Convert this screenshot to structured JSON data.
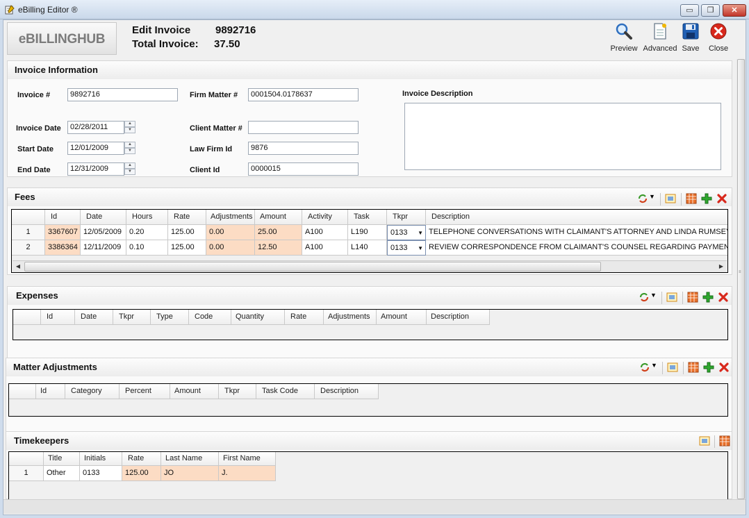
{
  "window": {
    "title": "eBilling Editor ®",
    "min_glyph": "▭",
    "max_glyph": "❐",
    "close_glyph": "✕"
  },
  "header": {
    "logo": "eBILLINGHUB",
    "edit_invoice_label": "Edit Invoice",
    "edit_invoice_value": "9892716",
    "total_invoice_label": "Total Invoice:",
    "total_invoice_value": "37.50",
    "toolbar": [
      {
        "label": "Preview",
        "icon": "magnifier-icon"
      },
      {
        "label": "Advanced",
        "icon": "document-icon"
      },
      {
        "label": "Save",
        "icon": "floppy-disk-icon"
      },
      {
        "label": "Close",
        "icon": "close-icon"
      }
    ]
  },
  "invoice_info": {
    "title": "Invoice Information",
    "invoice_no_label": "Invoice #",
    "invoice_no": "9892716",
    "invoice_date_label": "Invoice Date",
    "invoice_date": "02/28/2011",
    "start_date_label": "Start Date",
    "start_date": "12/01/2009",
    "end_date_label": "End Date",
    "end_date": "12/31/2009",
    "firm_matter_label": "Firm Matter #",
    "firm_matter": "0001504.0178637",
    "client_matter_label": "Client Matter #",
    "client_matter": "",
    "law_firm_id_label": "Law Firm Id",
    "law_firm_id": "9876",
    "client_id_label": "Client Id",
    "client_id": "0000015",
    "description_label": "Invoice Description",
    "description": ""
  },
  "fees": {
    "title": "Fees",
    "columns": [
      "",
      "Id",
      "Date",
      "Hours",
      "Rate",
      "Adjustments",
      "Amount",
      "Activity",
      "Task",
      "Tkpr",
      "Description"
    ],
    "rows": [
      [
        "1",
        "3367607",
        "12/05/2009",
        "0.20",
        "125.00",
        "0.00",
        "25.00",
        "A100",
        "L190",
        "0133",
        "TELEPHONE CONVERSATIONS WITH CLAIMANT'S ATTORNEY AND LINDA RUMSEY"
      ],
      [
        "2",
        "3386364",
        "12/11/2009",
        "0.10",
        "125.00",
        "0.00",
        "12.50",
        "A100",
        "L140",
        "0133",
        "REVIEW CORRESPONDENCE FROM CLAIMANT'S COUNSEL REGARDING PAYMENT"
      ]
    ]
  },
  "expenses": {
    "title": "Expenses",
    "columns": [
      "",
      "Id",
      "Date",
      "Tkpr",
      "Type",
      "Code",
      "Quantity",
      "Rate",
      "Adjustments",
      "Amount",
      "Description"
    ]
  },
  "matter_adjustments": {
    "title": "Matter Adjustments",
    "columns": [
      "",
      "Id",
      "Category",
      "Percent",
      "Amount",
      "Tkpr",
      "Task Code",
      "Description"
    ]
  },
  "timekeepers": {
    "title": "Timekeepers",
    "columns": [
      "",
      "Title",
      "Initials",
      "Rate",
      "Last Name",
      "First Name"
    ],
    "rows": [
      [
        "1",
        "Other",
        "0133",
        "125.00",
        "JO",
        "J."
      ]
    ]
  },
  "colors": {
    "peach": "#fcdcc4",
    "accent_blue": "#1f5fb4",
    "close_red": "#d8281c"
  }
}
